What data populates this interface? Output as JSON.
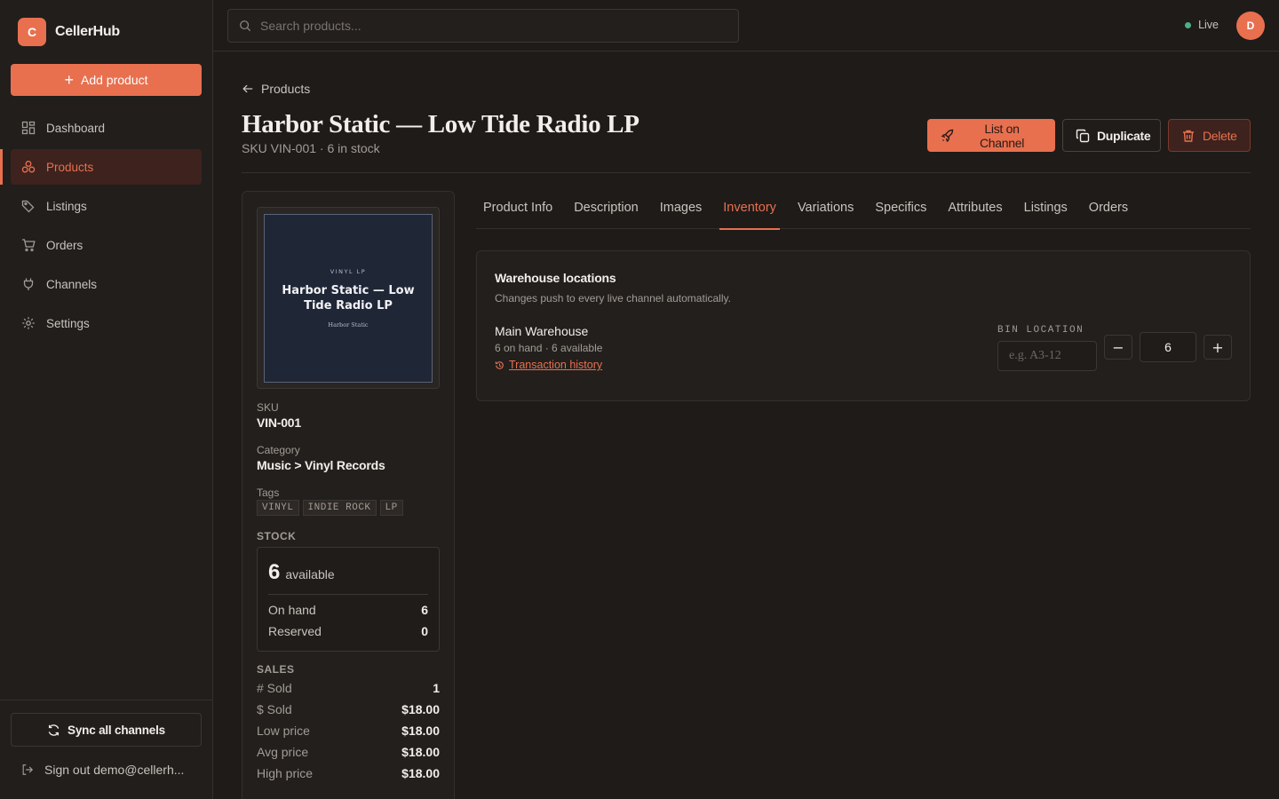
{
  "brand": {
    "logo_letter": "C",
    "name": "CellerHub"
  },
  "sidebar": {
    "add_label": "Add product",
    "items": [
      {
        "label": "Dashboard",
        "icon": "dashboard-icon"
      },
      {
        "label": "Products",
        "icon": "products-icon",
        "active": true
      },
      {
        "label": "Listings",
        "icon": "tag-icon"
      },
      {
        "label": "Orders",
        "icon": "cart-icon"
      },
      {
        "label": "Channels",
        "icon": "plug-icon"
      },
      {
        "label": "Settings",
        "icon": "gear-icon"
      }
    ],
    "sync_label": "Sync all channels",
    "signout_label": "Sign out demo@cellerh..."
  },
  "topbar": {
    "search_placeholder": "Search products...",
    "status_label": "Live",
    "avatar_letter": "D"
  },
  "page": {
    "back_label": "Products",
    "title": "Harbor Static — Low Tide Radio LP",
    "subtitle": "SKU VIN-001 · 6 in stock",
    "actions": {
      "list_label": "List on Channel",
      "duplicate_label": "Duplicate",
      "delete_label": "Delete"
    }
  },
  "product": {
    "cover": {
      "kicker": "VINYL LP",
      "title": "Harbor Static — Low Tide Radio LP",
      "artist": "Harbor Static"
    },
    "sku_label": "SKU",
    "sku": "VIN-001",
    "category_label": "Category",
    "category": "Music > Vinyl Records",
    "tags_label": "Tags",
    "tags": [
      "VINYL",
      "INDIE ROCK",
      "LP"
    ],
    "stock_label": "STOCK",
    "stock": {
      "available": "6",
      "available_label": "available",
      "on_hand_label": "On hand",
      "on_hand": "6",
      "reserved_label": "Reserved",
      "reserved": "0"
    },
    "sales_label": "SALES",
    "sales": [
      {
        "label": "# Sold",
        "value": "1"
      },
      {
        "label": "$ Sold",
        "value": "$18.00"
      },
      {
        "label": "Low price",
        "value": "$18.00"
      },
      {
        "label": "Avg price",
        "value": "$18.00"
      },
      {
        "label": "High price",
        "value": "$18.00"
      }
    ]
  },
  "tabs": [
    "Product Info",
    "Description",
    "Images",
    "Inventory",
    "Variations",
    "Specifics",
    "Attributes",
    "Listings",
    "Orders"
  ],
  "active_tab": "Inventory",
  "warehouse": {
    "title": "Warehouse locations",
    "subtitle": "Changes push to every live channel automatically.",
    "name": "Main Warehouse",
    "meta": "6 on hand · 6 available",
    "history_label": "Transaction history",
    "bin_label": "BIN LOCATION",
    "bin_placeholder": "e.g. A3-12",
    "quantity": "6",
    "minus": "−",
    "plus": "+"
  },
  "colors": {
    "accent": "#e8704f",
    "background": "#1e1b19",
    "live": "#4caf8a"
  }
}
